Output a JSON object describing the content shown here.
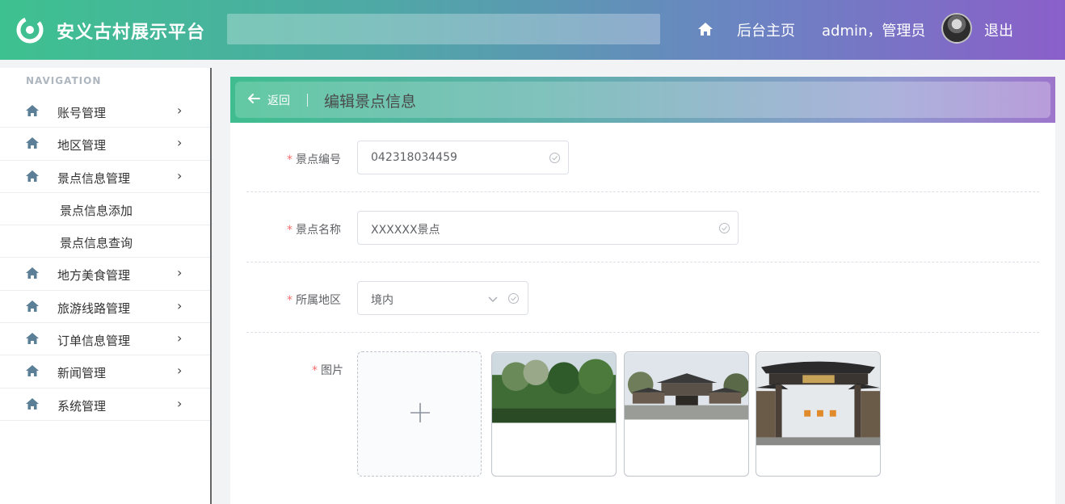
{
  "header": {
    "app_title": "安义古村展示平台",
    "home_label": "后台主页",
    "user_label": "admin，管理员",
    "logout_label": "退出"
  },
  "sidebar": {
    "heading": "NAVIGATION",
    "items": [
      {
        "label": "账号管理",
        "icon": "home-icon"
      },
      {
        "label": "地区管理",
        "icon": "home-icon"
      },
      {
        "label": "景点信息管理",
        "icon": "home-icon"
      },
      {
        "label": "景点信息添加",
        "sub": true
      },
      {
        "label": "景点信息查询",
        "sub": true
      },
      {
        "label": "地方美食管理",
        "icon": "home-icon"
      },
      {
        "label": "旅游线路管理",
        "icon": "home-icon"
      },
      {
        "label": "订单信息管理",
        "icon": "home-icon"
      },
      {
        "label": "新闻管理",
        "icon": "home-icon"
      },
      {
        "label": "系统管理",
        "icon": "home-icon"
      }
    ]
  },
  "page": {
    "back_label": "返回",
    "title": "编辑景点信息"
  },
  "form": {
    "code_label": "景点编号",
    "code_value": "042318034459",
    "name_label": "景点名称",
    "name_value": "XXXXXX景点",
    "region_label": "所属地区",
    "region_value": "境内",
    "image_label": "图片",
    "image_count": 3
  },
  "colors": {
    "header_start": "#3ec190",
    "header_end": "#8a5fc9",
    "required": "#f56c6c"
  }
}
